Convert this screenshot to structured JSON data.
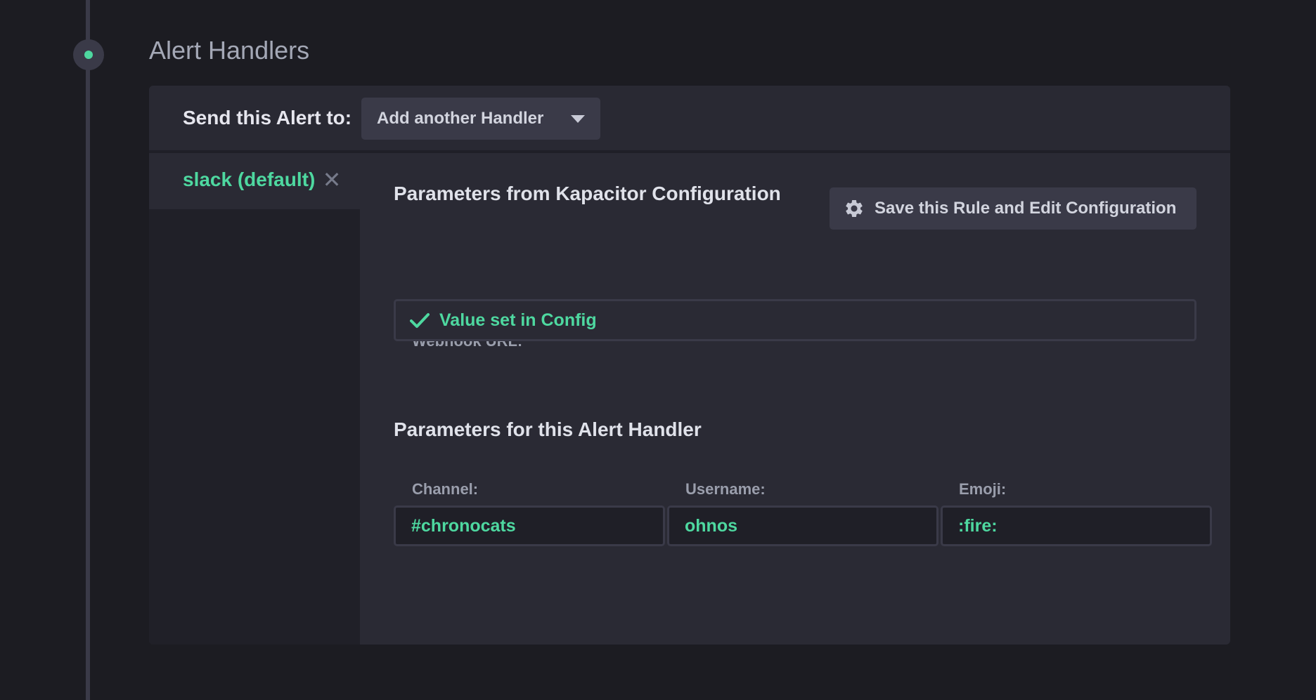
{
  "section": {
    "title": "Alert Handlers"
  },
  "header": {
    "send_label": "Send this Alert to:",
    "add_handler_label": "Add another Handler"
  },
  "handlers": [
    {
      "label": "slack (default)",
      "selected": true
    }
  ],
  "config": {
    "heading": "Parameters from Kapacitor Configuration",
    "save_button_label": "Save this Rule and Edit Configuration",
    "webhook": {
      "label": "Webhook URL:",
      "value": "Value set in Config"
    }
  },
  "handler_params": {
    "heading": "Parameters for this Alert Handler",
    "channel": {
      "label": "Channel:",
      "value": "#chronocats"
    },
    "username": {
      "label": "Username:",
      "value": "ohnos"
    },
    "emoji": {
      "label": "Emoji:",
      "value": ":fire:"
    }
  },
  "colors": {
    "accent": "#4ed8a0",
    "background": "#1c1c22",
    "panel": "#2a2a34",
    "control": "#3a3a48"
  },
  "icons": [
    "caret-down-icon",
    "close-icon",
    "gear-icon",
    "check-icon"
  ]
}
